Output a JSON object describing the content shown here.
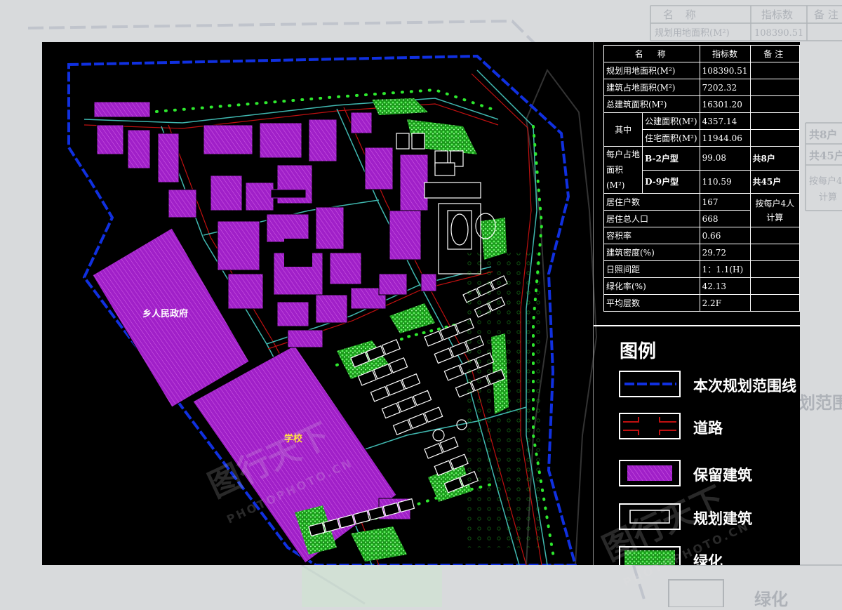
{
  "watermark": {
    "brand": "图行天下",
    "site": "PHOTOPHOTO.CN"
  },
  "table": {
    "header": {
      "name": "名　称",
      "value": "指标数",
      "note": "备注"
    },
    "rows": {
      "planning_area": {
        "label": "规划用地面积(M²)",
        "value": "108390.51"
      },
      "footprint_area": {
        "label": "建筑占地面积(M²)",
        "value": "7202.32"
      },
      "total_floor_area": {
        "label": "总建筑面积(M²)",
        "value": "16301.20"
      },
      "of_which": "其中",
      "public_area": {
        "label": "公建面积(M²)",
        "value": "4357.14"
      },
      "residential_area": {
        "label": "住宅面积(M²)",
        "value": "11944.06"
      },
      "per_household_label": "每户占地面积(M²)",
      "type_b2": {
        "label": "B-2户型",
        "value": "99.08",
        "note": "共8户"
      },
      "type_d9": {
        "label": "D-9户型",
        "value": "110.59",
        "note": "共45户"
      },
      "households": {
        "label": "居住户数",
        "value": "167"
      },
      "population": {
        "label": "居住总人口",
        "value": "668",
        "note": "按每户4人计算"
      },
      "far": {
        "label": "容积率",
        "value": "0.66"
      },
      "density": {
        "label": "建筑密度(%)",
        "value": "29.72"
      },
      "sunlight": {
        "label": "日照间距",
        "value": "1：1.1(H)"
      },
      "green_rate": {
        "label": "绿化率(%)",
        "value": "42.13"
      },
      "avg_floors": {
        "label": "平均层数",
        "value": "2.2F"
      }
    }
  },
  "legend": {
    "title": "图例",
    "items": [
      {
        "label": "本次规划范围线",
        "symbol": "boundary-line"
      },
      {
        "label": "道路",
        "symbol": "road"
      },
      {
        "label": "保留建筑",
        "symbol": "retained-building"
      },
      {
        "label": "规划建筑",
        "symbol": "planned-building"
      },
      {
        "label": "绿化",
        "symbol": "greenery"
      }
    ]
  },
  "map": {
    "labels": {
      "gov": "乡人民政府",
      "school": "学校"
    }
  },
  "colors": {
    "background": "#000000",
    "boundary": "#1030e0",
    "retained": "#a020c8",
    "road": "#c01010",
    "planned": "#ffffff",
    "green": "#22d822",
    "road_edge": "#40b8b0"
  }
}
